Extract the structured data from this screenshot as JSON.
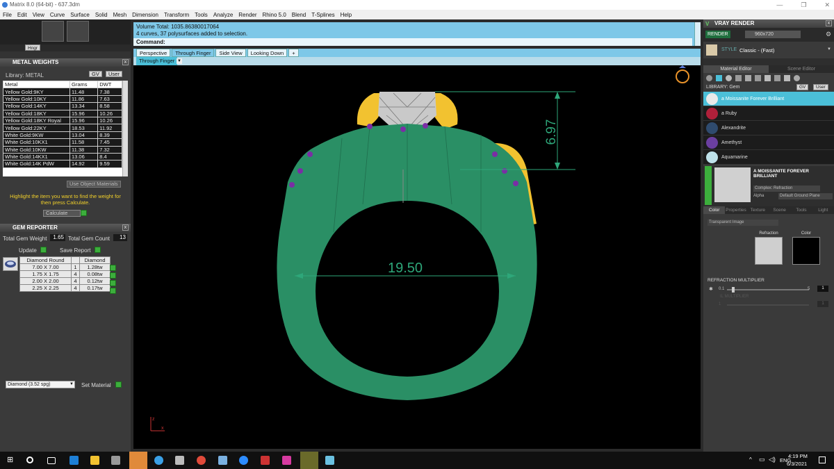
{
  "window": {
    "title": "Matrix 8.0 (64-bit) - 637.3dm",
    "buttons": [
      "—",
      "❐",
      "✕"
    ]
  },
  "menu": [
    "File",
    "Edit",
    "View",
    "Curve",
    "Surface",
    "Solid",
    "Mesh",
    "Dimension",
    "Transform",
    "Tools",
    "Analyze",
    "Render",
    "Rhino 5.0",
    "Blend",
    "T-Splines",
    "Help"
  ],
  "left": {
    "toolbar_btn": "Hngr",
    "metal_weights": {
      "title": "METAL WEIGHTS",
      "library_label": "Library: METAL",
      "gv": "GV",
      "user": "User",
      "columns": [
        "Metal",
        "Grams",
        "DWT"
      ],
      "rows": [
        [
          "Yellow Gold:9KY",
          "11.48",
          "7.38"
        ],
        [
          "Yellow Gold:10KY",
          "11.86",
          "7.63"
        ],
        [
          "Yellow Gold:14KY",
          "13.34",
          "8.58"
        ],
        [
          "Yellow Gold:18KY",
          "15.96",
          "10.26"
        ],
        [
          "Yellow Gold:18KY Royal",
          "15.96",
          "10.26"
        ],
        [
          "Yellow Gold:22KY",
          "18.53",
          "11.92"
        ],
        [
          "White Gold:9KW",
          "13.04",
          "8.39"
        ],
        [
          "White Gold:10KX1",
          "11.58",
          "7.45"
        ],
        [
          "White Gold:10KW",
          "11.38",
          "7.32"
        ],
        [
          "White Gold:14KX1",
          "13.06",
          "8.4"
        ],
        [
          "White Gold:14K PdW",
          "14.92",
          "9.59"
        ]
      ],
      "use_object": "Use Object Materials",
      "hint": "Highlight the item you want to find the weight for then press Calculate.",
      "calculate": "Calculate"
    },
    "gem_reporter": {
      "title": "GEM REPORTER",
      "total_weight_label": "Total Gem Weight",
      "total_weight": "1.65",
      "total_count_label": "Total Gem Count",
      "total_count": "13",
      "update": "Update",
      "save_report": "Save Report",
      "header": [
        "Diamond Round",
        "",
        "Diamond"
      ],
      "rows": [
        [
          "7.00 X 7.00",
          "1",
          "1.28tw"
        ],
        [
          "1.75 X 1.75",
          "4",
          "0.08tw"
        ],
        [
          "2.00 X 2.00",
          "4",
          "0.12tw"
        ],
        [
          "2.25 X 2.25",
          "4",
          "0.17tw"
        ]
      ]
    },
    "material_select": "Diamond     (3.52 spg)",
    "set_material": "Set Material"
  },
  "center": {
    "cmd_line1": "Volume Total: 1035.86380017064",
    "cmd_line2": "4 curves, 37 polysurfaces added to selection.",
    "cmd_label": "Command:",
    "tabs": [
      "Perspective",
      "Through Finger",
      "Side View",
      "Looking Down"
    ],
    "active_view": "Through Finger",
    "dim_height": "6.97",
    "dim_width": "19.50",
    "axis_z": "z",
    "axis_x": "x"
  },
  "right": {
    "title": "VRAY RENDER",
    "render_btn": "RENDER",
    "resolution": "960x720",
    "style_label": "STYLE",
    "style_value": "Classic - (Fast)",
    "tabs": [
      "Material Editor",
      "Scene Editor"
    ],
    "library_label": "LIBRARY: Gem",
    "gv": "GV",
    "user": "User",
    "materials": [
      {
        "name": "a Moissanite Forever Brilliant",
        "color": "#e9e9e9"
      },
      {
        "name": "a Ruby",
        "color": "#b0203a"
      },
      {
        "name": "Alexandrite",
        "color": "#2f4b6e"
      },
      {
        "name": "Amethyst",
        "color": "#6b3fa0"
      },
      {
        "name": "Aquamarine",
        "color": "#bfe2ea"
      }
    ],
    "preview_name": "A MOISSANITE FOREVER BRILLIANT",
    "complex": "Complex: Refraction",
    "alpha": "Alpha",
    "ground": "Default Ground Plane",
    "prop_tabs": [
      "Color",
      "Properties",
      "Texture",
      "Scene",
      "Tools",
      "Light"
    ],
    "transparent": "Transparent Image",
    "refraction": "Refraction",
    "color": "Color",
    "refraction_mult": "REFRACTION MULTIPLIER",
    "slider_min": "0.1",
    "slider_max": "5",
    "slider_val": "1",
    "slider_level": 0.06,
    "ior_label": "IL MULTIPLIER",
    "ior_min": "1",
    "ior_val": "1"
  },
  "taskbar": {
    "lang": "ENG",
    "time": "4:19 PM",
    "date": "6/3/2021"
  },
  "colors": {
    "ring_green": "#2a8f65",
    "gold": "#f2c230",
    "dim_green": "#2ea77a",
    "cmd_blue": "#7ec8e8",
    "accent": "#4bbfd8"
  }
}
